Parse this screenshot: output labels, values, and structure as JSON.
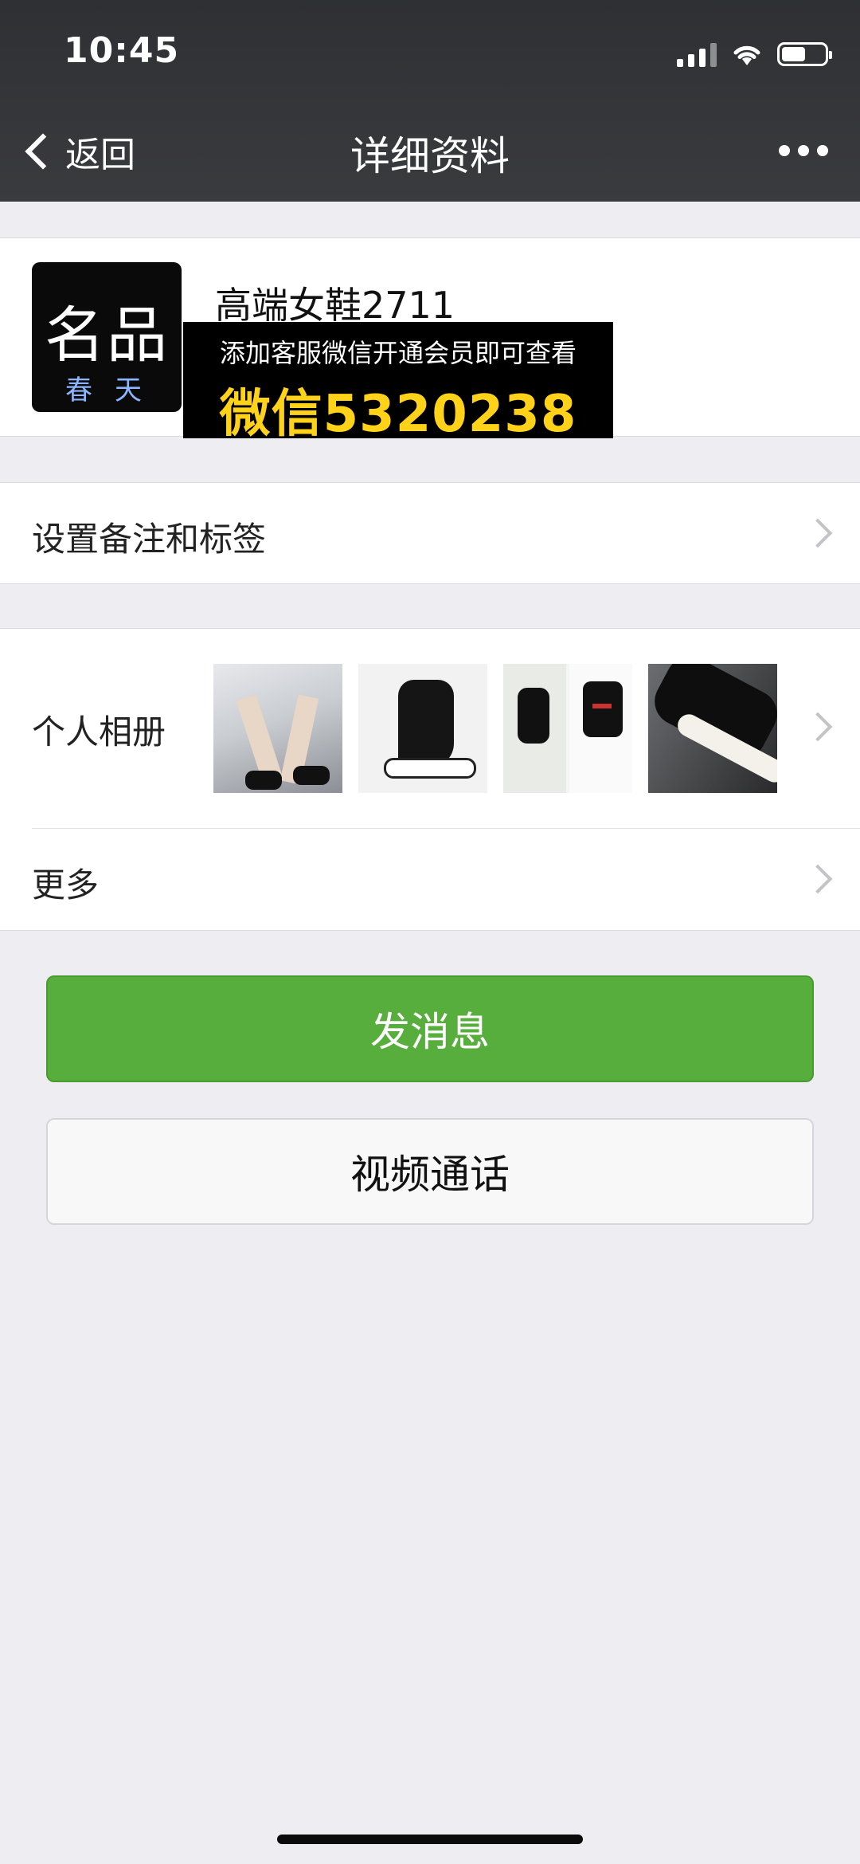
{
  "status_bar": {
    "time": "10:45",
    "icons": [
      "signal-icon",
      "wifi-icon",
      "battery-icon"
    ],
    "battery_level": 0.55
  },
  "nav": {
    "back_label": "返回",
    "title": "详细资料",
    "more_icon": "more-dots-icon"
  },
  "profile": {
    "avatar_text_large": "名品",
    "avatar_text_small": "春天",
    "name": "高端女鞋2711",
    "promo_line1": "添加客服微信开通会员即可查看",
    "promo_line2": "微信5320238"
  },
  "rows": {
    "remark_label": "设置备注和标签",
    "album_label": "个人相册",
    "more_label": "更多"
  },
  "album": {
    "photos": [
      "photo-legs-black-sock-sneakers",
      "photo-hand-holding-sock-sneaker",
      "photo-model-black-outfit",
      "photo-sneaker-closeup"
    ]
  },
  "buttons": {
    "send_message": "发消息",
    "video_call": "视频通话"
  },
  "colors": {
    "topbar": "#333437",
    "background": "#EDEDF2",
    "primary_green": "#58AE3D",
    "promo_yellow": "#FFD21A"
  }
}
